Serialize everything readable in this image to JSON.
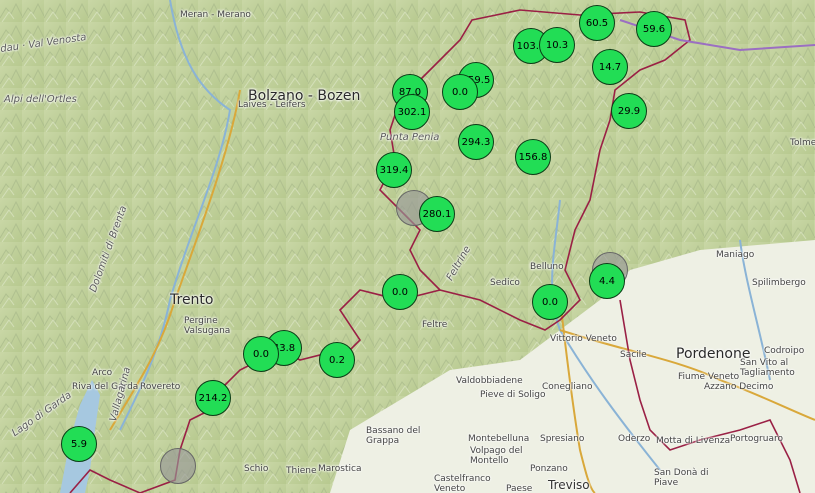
{
  "places": [
    {
      "id": "merano",
      "text": "Meran - Merano",
      "cls": "small"
    },
    {
      "id": "bolzano",
      "text": "Bolzano - Bozen",
      "cls": "big"
    },
    {
      "id": "laives",
      "text": "Laives - Leifers",
      "cls": "small"
    },
    {
      "id": "trento",
      "text": "Trento",
      "cls": "big"
    },
    {
      "id": "pergine",
      "text": "Pergine\nValsugana",
      "cls": "small"
    },
    {
      "id": "arco",
      "text": "Arco",
      "cls": "small"
    },
    {
      "id": "riva",
      "text": "Riva del Garda",
      "cls": "small"
    },
    {
      "id": "rovereto",
      "text": "Rovereto",
      "cls": "small"
    },
    {
      "id": "schio",
      "text": "Schio",
      "cls": "small"
    },
    {
      "id": "thiene",
      "text": "Thiene",
      "cls": "small"
    },
    {
      "id": "marostica",
      "text": "Marostica",
      "cls": "small"
    },
    {
      "id": "bassano",
      "text": "Bassano del\nGrappa",
      "cls": "small"
    },
    {
      "id": "feltre",
      "text": "Feltre",
      "cls": "small"
    },
    {
      "id": "belluno",
      "text": "Belluno",
      "cls": "small"
    },
    {
      "id": "sedico",
      "text": "Sedico",
      "cls": "small"
    },
    {
      "id": "vittorio",
      "text": "Vittorio Veneto",
      "cls": "small"
    },
    {
      "id": "valdobbiadene",
      "text": "Valdobbiadene",
      "cls": "small"
    },
    {
      "id": "pieve",
      "text": "Pieve di Soligo",
      "cls": "small"
    },
    {
      "id": "conegliano",
      "text": "Conegliano",
      "cls": "small"
    },
    {
      "id": "montebelluna",
      "text": "Montebelluna",
      "cls": "small"
    },
    {
      "id": "volpago",
      "text": "Volpago del\nMontello",
      "cls": "small"
    },
    {
      "id": "spresiano",
      "text": "Spresiano",
      "cls": "small"
    },
    {
      "id": "castelfranco",
      "text": "Castelfranco\nVeneto",
      "cls": "small"
    },
    {
      "id": "ponzano",
      "text": "Ponzano",
      "cls": "small"
    },
    {
      "id": "paese",
      "text": "Paese",
      "cls": "small"
    },
    {
      "id": "treviso",
      "text": "Treviso",
      "cls": "med"
    },
    {
      "id": "oderzo",
      "text": "Oderzo",
      "cls": "small"
    },
    {
      "id": "motta",
      "text": "Motta di Livenza",
      "cls": "small"
    },
    {
      "id": "portogruaro",
      "text": "Portogruaro",
      "cls": "small"
    },
    {
      "id": "sandona",
      "text": "San Donà di\nPiave",
      "cls": "small"
    },
    {
      "id": "sacile",
      "text": "Sacile",
      "cls": "small"
    },
    {
      "id": "pordenone",
      "text": "Pordenone",
      "cls": "big"
    },
    {
      "id": "fiume",
      "text": "Fiume Veneto",
      "cls": "small"
    },
    {
      "id": "azzano",
      "text": "Azzano Decimo",
      "cls": "small"
    },
    {
      "id": "sanvito",
      "text": "San Vito al\nTagliamento",
      "cls": "small"
    },
    {
      "id": "codroipo",
      "text": "Codroipo",
      "cls": "small"
    },
    {
      "id": "spilimbergo",
      "text": "Spilimbergo",
      "cls": "small"
    },
    {
      "id": "maniago",
      "text": "Maniago",
      "cls": "small"
    },
    {
      "id": "tolmezzo",
      "text": "Tolmez",
      "cls": "small"
    },
    {
      "id": "puntapenia",
      "text": "Punta Penia",
      "cls": "range"
    },
    {
      "id": "venosta",
      "text": "dau · Val Venosta",
      "cls": "range"
    },
    {
      "id": "ortles",
      "text": "Alpi dell'Ortles",
      "cls": "range"
    },
    {
      "id": "brenta",
      "text": "Dolomiti di Brenta",
      "cls": "range"
    },
    {
      "id": "feltrine",
      "text": "Feltrine",
      "cls": "range"
    },
    {
      "id": "garda",
      "text": "Lago di Garda",
      "cls": "range"
    },
    {
      "id": "vallagarina",
      "text": "Vallagarina",
      "cls": "range"
    }
  ],
  "markers": [
    {
      "id": "m1",
      "value": "60.5"
    },
    {
      "id": "m2",
      "value": "59.6"
    },
    {
      "id": "m3",
      "value": "103.4"
    },
    {
      "id": "m4",
      "value": "10.3"
    },
    {
      "id": "m5",
      "value": "14.7"
    },
    {
      "id": "m6",
      "value": "959.5"
    },
    {
      "id": "m7",
      "value": "0.0"
    },
    {
      "id": "m8",
      "value": "87.0"
    },
    {
      "id": "m9",
      "value": "302.1"
    },
    {
      "id": "m10",
      "value": "29.9"
    },
    {
      "id": "m11",
      "value": "294.3"
    },
    {
      "id": "m12",
      "value": "156.8"
    },
    {
      "id": "m13",
      "value": "319.4"
    },
    {
      "id": "m14",
      "value": "280.1"
    },
    {
      "id": "m15",
      "value": "4.4"
    },
    {
      "id": "m16",
      "value": "0.0"
    },
    {
      "id": "m17",
      "value": "0.0"
    },
    {
      "id": "m18",
      "value": "43.8"
    },
    {
      "id": "m19",
      "value": "0.0"
    },
    {
      "id": "m20",
      "value": "0.2"
    },
    {
      "id": "m21",
      "value": "214.2"
    },
    {
      "id": "m22",
      "value": "5.9"
    }
  ]
}
